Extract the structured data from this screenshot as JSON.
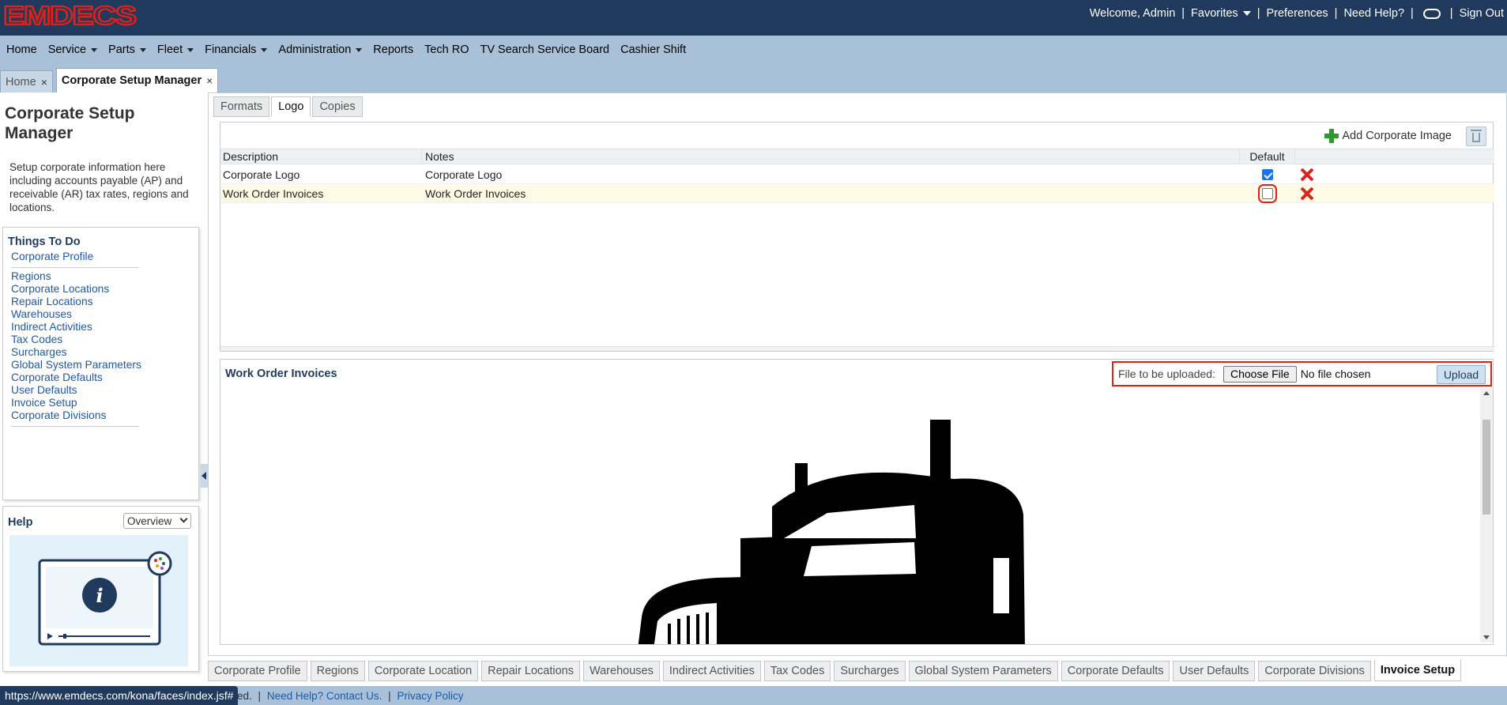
{
  "header": {
    "logo_text": "EMDECS",
    "welcome": "Welcome, Admin",
    "favorites": "Favorites",
    "preferences": "Preferences",
    "need_help": "Need Help?",
    "sign_out": "Sign Out",
    "sep": "|",
    "brand_color": "#e0201a",
    "bg_color": "#1f3a5c"
  },
  "menu": [
    {
      "label": "Home",
      "dropdown": false
    },
    {
      "label": "Service",
      "dropdown": true
    },
    {
      "label": "Parts",
      "dropdown": true
    },
    {
      "label": "Fleet",
      "dropdown": true
    },
    {
      "label": "Financials",
      "dropdown": true
    },
    {
      "label": "Administration",
      "dropdown": true
    },
    {
      "label": "Reports",
      "dropdown": false
    },
    {
      "label": "Tech RO",
      "dropdown": false
    },
    {
      "label": "TV Search Service Board",
      "dropdown": false
    },
    {
      "label": "Cashier Shift",
      "dropdown": false
    }
  ],
  "page_tabs": [
    {
      "label": "Home",
      "close": "×"
    },
    {
      "label": "Corporate Setup Manager",
      "close": "×"
    }
  ],
  "sidebar": {
    "title": "Corporate Setup Manager",
    "description": "Setup corporate information here including accounts payable (AP) and receivable (AR) tax rates, regions and locations.",
    "things_to_do_title": "Things To Do",
    "links": [
      "Corporate Profile",
      "Regions",
      "Corporate Locations",
      "Repair Locations",
      "Warehouses",
      "Indirect Activities",
      "Tax Codes",
      "Surcharges",
      "Global System Parameters",
      "Corporate Defaults",
      "User Defaults",
      "Invoice Setup",
      "Corporate Divisions"
    ],
    "help_title": "Help",
    "help_select": "Overview"
  },
  "subtabs": [
    "Formats",
    "Logo",
    "Copies"
  ],
  "grid": {
    "add_label": "Add Corporate Image",
    "columns": {
      "description": "Description",
      "notes": "Notes",
      "default": "Default"
    },
    "rows": [
      {
        "description": "Corporate Logo",
        "notes": "Corporate Logo",
        "default": true
      },
      {
        "description": "Work Order Invoices",
        "notes": "Work Order Invoices",
        "default": false
      }
    ]
  },
  "preview": {
    "title": "Work Order Invoices",
    "upload_label": "File to be uploaded:",
    "choose_file": "Choose File",
    "no_file": "No file chosen",
    "upload_button": "Upload"
  },
  "bottom_tabs": [
    "Corporate Profile",
    "Regions",
    "Corporate Location",
    "Repair Locations",
    "Warehouses",
    "Indirect Activities",
    "Tax Codes",
    "Surcharges",
    "Global System Parameters",
    "Corporate Defaults",
    "User Defaults",
    "Corporate Divisions",
    "Invoice Setup"
  ],
  "footer": {
    "fragment": "ed.",
    "need_help": "Need Help? Contact Us.",
    "privacy": "Privacy Policy",
    "status_url": "https://www.emdecs.com/kona/faces/index.jsf#"
  }
}
